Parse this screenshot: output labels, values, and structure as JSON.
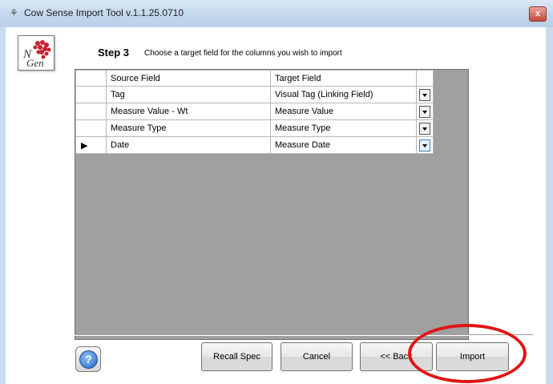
{
  "window": {
    "title": "Cow Sense Import Tool v.1.1.25.0710",
    "close_label": "x"
  },
  "header": {
    "logo_text": "N Gen",
    "step_label": "Step 3",
    "step_description": "Choose a target field for the columns you wish to import"
  },
  "grid": {
    "columns": [
      "Source Field",
      "Target Field"
    ],
    "rows": [
      {
        "source": "Tag",
        "target": "Visual Tag (Linking Field)",
        "current": false
      },
      {
        "source": "Measure Value - Wt",
        "target": "Measure Value",
        "current": false
      },
      {
        "source": "Measure Type",
        "target": "Measure Type",
        "current": false
      },
      {
        "source": "Date",
        "target": "Measure Date",
        "current": true
      }
    ],
    "current_row_marker": "▶"
  },
  "footer": {
    "help_label": "?",
    "recall_label": "Recall Spec",
    "cancel_label": "Cancel",
    "back_label": "<< Back",
    "import_label": "Import"
  },
  "colors": {
    "highlight_ellipse": "#e01414",
    "grid_background": "#a0a0a0"
  }
}
